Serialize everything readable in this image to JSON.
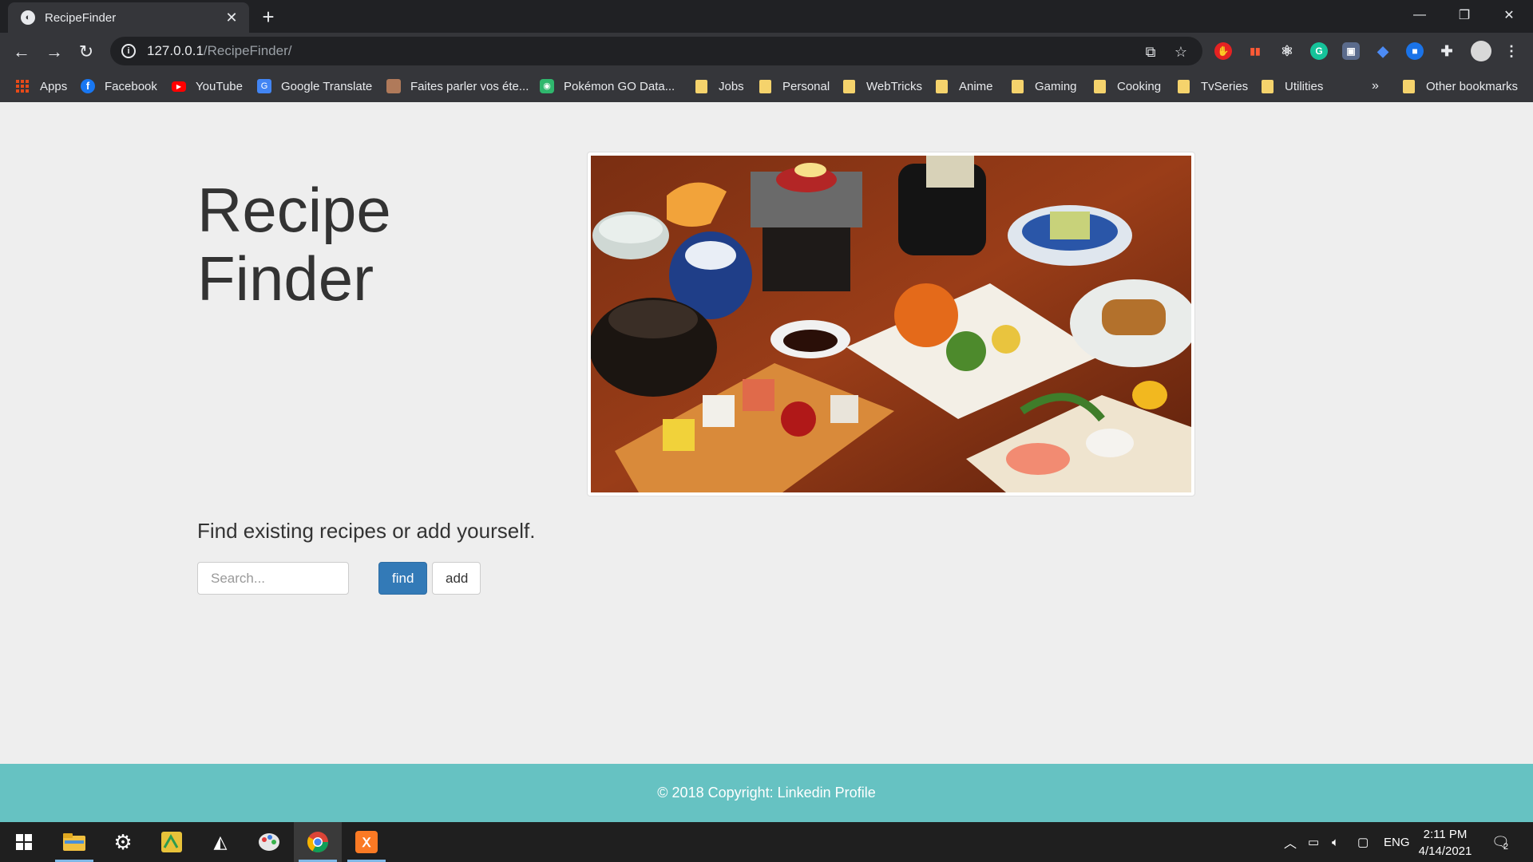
{
  "browser": {
    "tab_title": "RecipeFinder",
    "url_host": "127.0.0.1",
    "url_path": "/RecipeFinder/",
    "bookmarks": [
      {
        "label": "Apps",
        "icon": "apps-grid-icon"
      },
      {
        "label": "Facebook",
        "icon": "facebook-icon"
      },
      {
        "label": "YouTube",
        "icon": "youtube-icon"
      },
      {
        "label": "Google Translate",
        "icon": "google-translate-icon"
      },
      {
        "label": "Faites parler vos éte...",
        "icon": "page-favicon-icon"
      },
      {
        "label": "Pokémon GO Data...",
        "icon": "pokemon-go-icon"
      },
      {
        "label": "Jobs",
        "icon": "folder-icon"
      },
      {
        "label": "Personal",
        "icon": "folder-icon"
      },
      {
        "label": "WebTricks",
        "icon": "folder-icon"
      },
      {
        "label": "Anime",
        "icon": "folder-icon"
      },
      {
        "label": "Gaming",
        "icon": "folder-icon"
      },
      {
        "label": "Cooking",
        "icon": "folder-icon"
      },
      {
        "label": "TvSeries",
        "icon": "folder-icon"
      },
      {
        "label": "Utilities",
        "icon": "folder-icon"
      }
    ],
    "overflow_label": "»",
    "other_bookmarks": "Other bookmarks"
  },
  "page": {
    "title_line1": "Recipe",
    "title_line2": "Finder",
    "lead": "Find existing recipes or add yourself.",
    "search_placeholder": "Search...",
    "find_label": "find",
    "add_label": "add",
    "footer_text": "© 2018 Copyright: Linkedin Profile"
  },
  "taskbar": {
    "language": "ENG",
    "time": "2:11 PM",
    "date": "4/14/2021",
    "notification_count": "2"
  },
  "colors": {
    "primary_button": "#337ab7",
    "footer": "#66c2c2",
    "page_background": "#eeeeee"
  }
}
